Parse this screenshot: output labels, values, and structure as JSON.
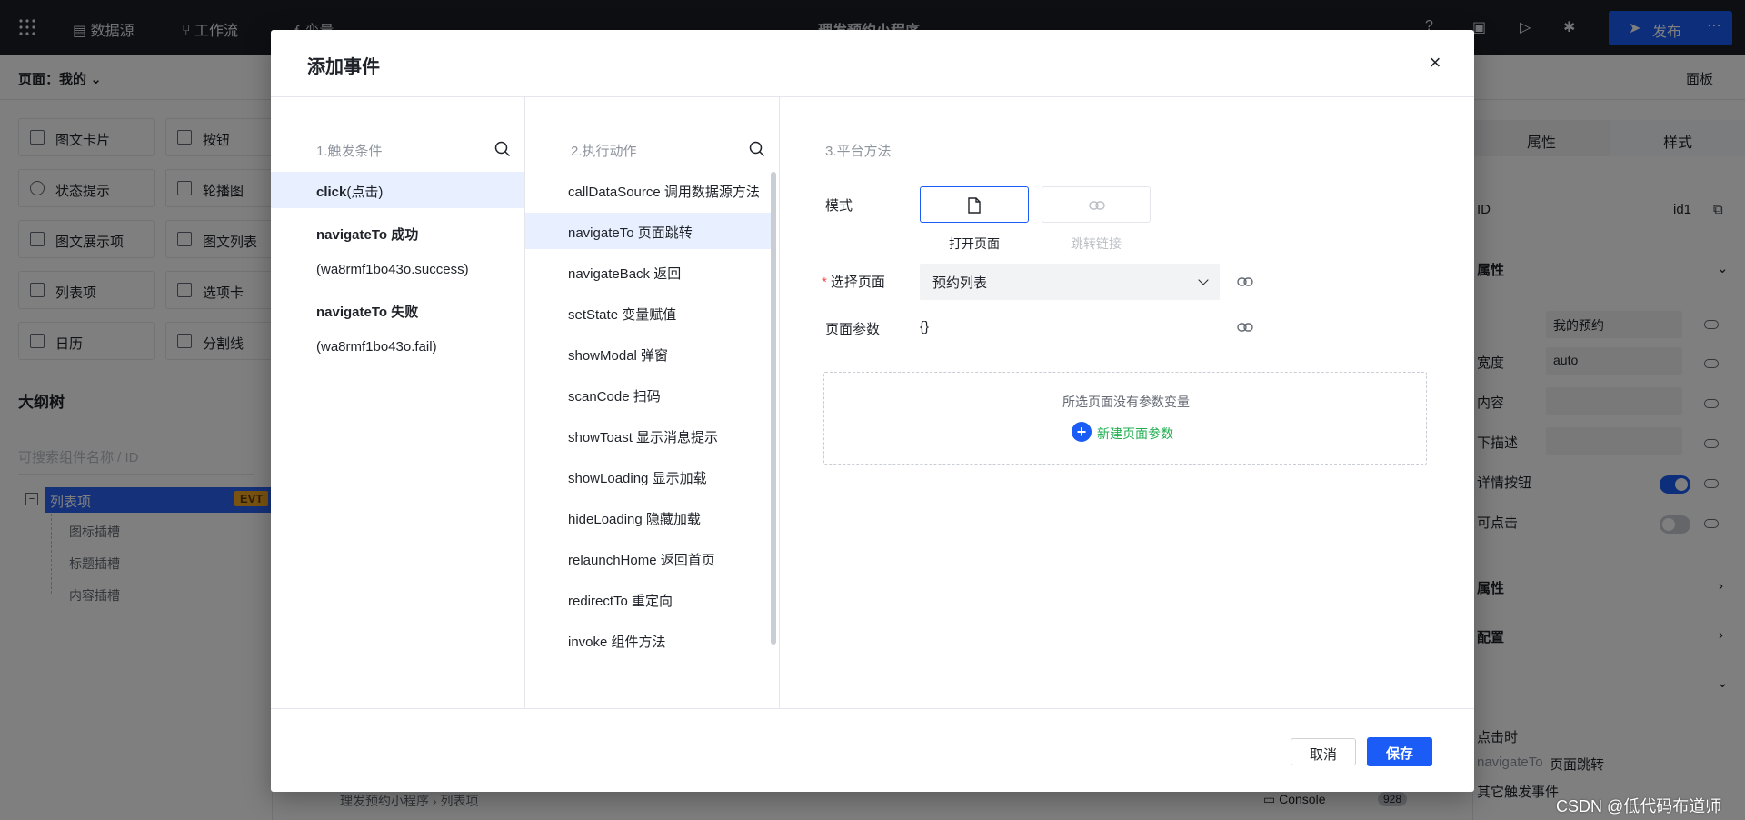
{
  "topbar": {
    "datasource_label": "数据源",
    "workflow_label": "工作流",
    "variable_label": "变量",
    "app_title": "理发预约小程序",
    "publish_label": "发布"
  },
  "subbar": {
    "page_selector": "页面：我的",
    "panel_label": "面板"
  },
  "components": [
    {
      "label": "图文卡片"
    },
    {
      "label": "按钮"
    },
    {
      "label": "状态提示"
    },
    {
      "label": "轮播图"
    },
    {
      "label": "图文展示项"
    },
    {
      "label": "图文列表"
    },
    {
      "label": "列表项"
    },
    {
      "label": "选项卡"
    },
    {
      "label": "日历"
    },
    {
      "label": "分割线"
    }
  ],
  "outline": {
    "title": "大纲树",
    "search_placeholder": "可搜索组件名称 / ID",
    "selected_node": "列表项",
    "badge": "EVT",
    "children": [
      "图标插槽",
      "标题插槽",
      "内容插槽"
    ]
  },
  "bottombar": {
    "breadcrumb": "理发预约小程序  ›  列表项",
    "console_label": "Console",
    "console_count": "928"
  },
  "right_panel": {
    "tab_props": "属性",
    "tab_style": "样式",
    "id_label": "ID",
    "id_value": "id1",
    "section_attr": "属性",
    "title_value": "我的预约",
    "width_label": "宽度",
    "width_value": "auto",
    "content_label": "内容",
    "desc_label": "下描述",
    "detail_btn_label": "详情按钮",
    "clickable_label": "可点击",
    "section2": "属性",
    "section3": "配置",
    "event_click": "点击时",
    "event_nav_label": "navigateTo",
    "event_nav_value": "页面跳转",
    "other_event": "其它触发事件"
  },
  "dialog": {
    "title": "添加事件",
    "close": "×",
    "trigger": {
      "header": "1.触发条件",
      "items": [
        {
          "name": "click",
          "desc": "(点击)"
        },
        {
          "name": "navigateTo 成功",
          "sub": "(wa8rmf1bo43o.success)"
        },
        {
          "name": "navigateTo 失败",
          "sub": "(wa8rmf1bo43o.fail)"
        }
      ]
    },
    "action": {
      "header": "2.执行动作",
      "items": [
        "callDataSource 调用数据源方法",
        "navigateTo 页面跳转",
        "navigateBack 返回",
        "setState 变量赋值",
        "showModal 弹窗",
        "scanCode 扫码",
        "showToast 显示消息提示",
        "showLoading 显示加载",
        "hideLoading 隐藏加载",
        "relaunchHome 返回首页",
        "redirectTo 重定向",
        "invoke 组件方法"
      ]
    },
    "platform": {
      "header": "3.平台方法",
      "mode_label": "模式",
      "mode_open_page": "打开页面",
      "mode_jump_link": "跳转链接",
      "required_mark": "*",
      "select_page_label": "选择页面",
      "select_page_value": "预约列表",
      "page_params_label": "页面参数",
      "page_params_value": "{}",
      "empty_params_text": "所选页面没有参数变量",
      "new_param_label": "新建页面参数"
    },
    "cancel_label": "取消",
    "save_label": "保存"
  },
  "watermark": "CSDN @低代码布道师",
  "colors": {
    "accent": "#1a5cf5",
    "selected_bg": "#e8effe",
    "new_param_green": "#1fae50",
    "required_red": "#f54a45"
  }
}
